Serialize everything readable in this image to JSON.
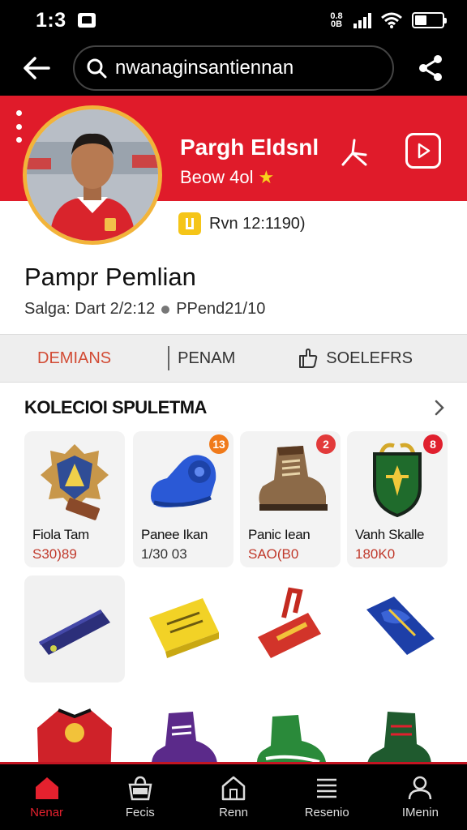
{
  "status_bar": {
    "time": "1:3",
    "network_top": "0.8",
    "network_bottom": "0B"
  },
  "top_bar": {
    "search_text": "nwanaginsantiennan"
  },
  "profile": {
    "name": "Pargh Eldsnl",
    "subtitle": "Beow 4ol",
    "meta_text": "Rvn 12:1190)",
    "banner_color": "#e01b2a",
    "avatar_border_color": "#f2b43a"
  },
  "section": {
    "title": "Pampr Pemlian",
    "sub_left": "Salga: Dart 2/2:12",
    "sub_right": "PPend21/10"
  },
  "tabs": [
    {
      "label": "DEMIANS"
    },
    {
      "label": "PENAM"
    },
    {
      "label": "SOELEFRS"
    }
  ],
  "collection": {
    "title": "KOLECIOI SPULETMA"
  },
  "products": [
    {
      "title": "Fiola Tam",
      "price": "S30)89",
      "badge": "",
      "icon": "emblem-badge-icon"
    },
    {
      "title": "Panee Ikan",
      "price": "1/30 03",
      "badge": "13",
      "badge_color": "#f07a1a",
      "icon": "blue-shoe-icon"
    },
    {
      "title": "Panic Iean",
      "price": "SAO(B0",
      "badge": "2",
      "badge_color": "#e23a3a",
      "icon": "brown-boot-icon"
    },
    {
      "title": "Vanh Skalle",
      "price": "180K0",
      "badge": "8",
      "badge_color": "#e0202e",
      "icon": "green-shield-icon"
    }
  ],
  "items": [
    {
      "icon": "navy-case-icon"
    },
    {
      "icon": "yellow-wallet-icon"
    },
    {
      "icon": "red-scarf-icon"
    },
    {
      "icon": "blue-bag-icon"
    },
    {
      "icon": "red-jersey-icon"
    },
    {
      "icon": "purple-boot-icon"
    },
    {
      "icon": "green-cleat-icon"
    },
    {
      "icon": "green-boot-icon"
    }
  ],
  "bottom_nav": [
    {
      "label": "Nenar",
      "icon": "home-icon",
      "active": true
    },
    {
      "label": "Fecis",
      "icon": "basket-icon",
      "active": false
    },
    {
      "label": "Renn",
      "icon": "store-icon",
      "active": false
    },
    {
      "label": "Resenio",
      "icon": "menu-icon",
      "active": false
    },
    {
      "label": "IMenin",
      "icon": "person-icon",
      "active": false
    }
  ],
  "colors": {
    "accent": "#e01b2a",
    "active_tab": "#d24b34",
    "nav_active": "#e5212e"
  }
}
